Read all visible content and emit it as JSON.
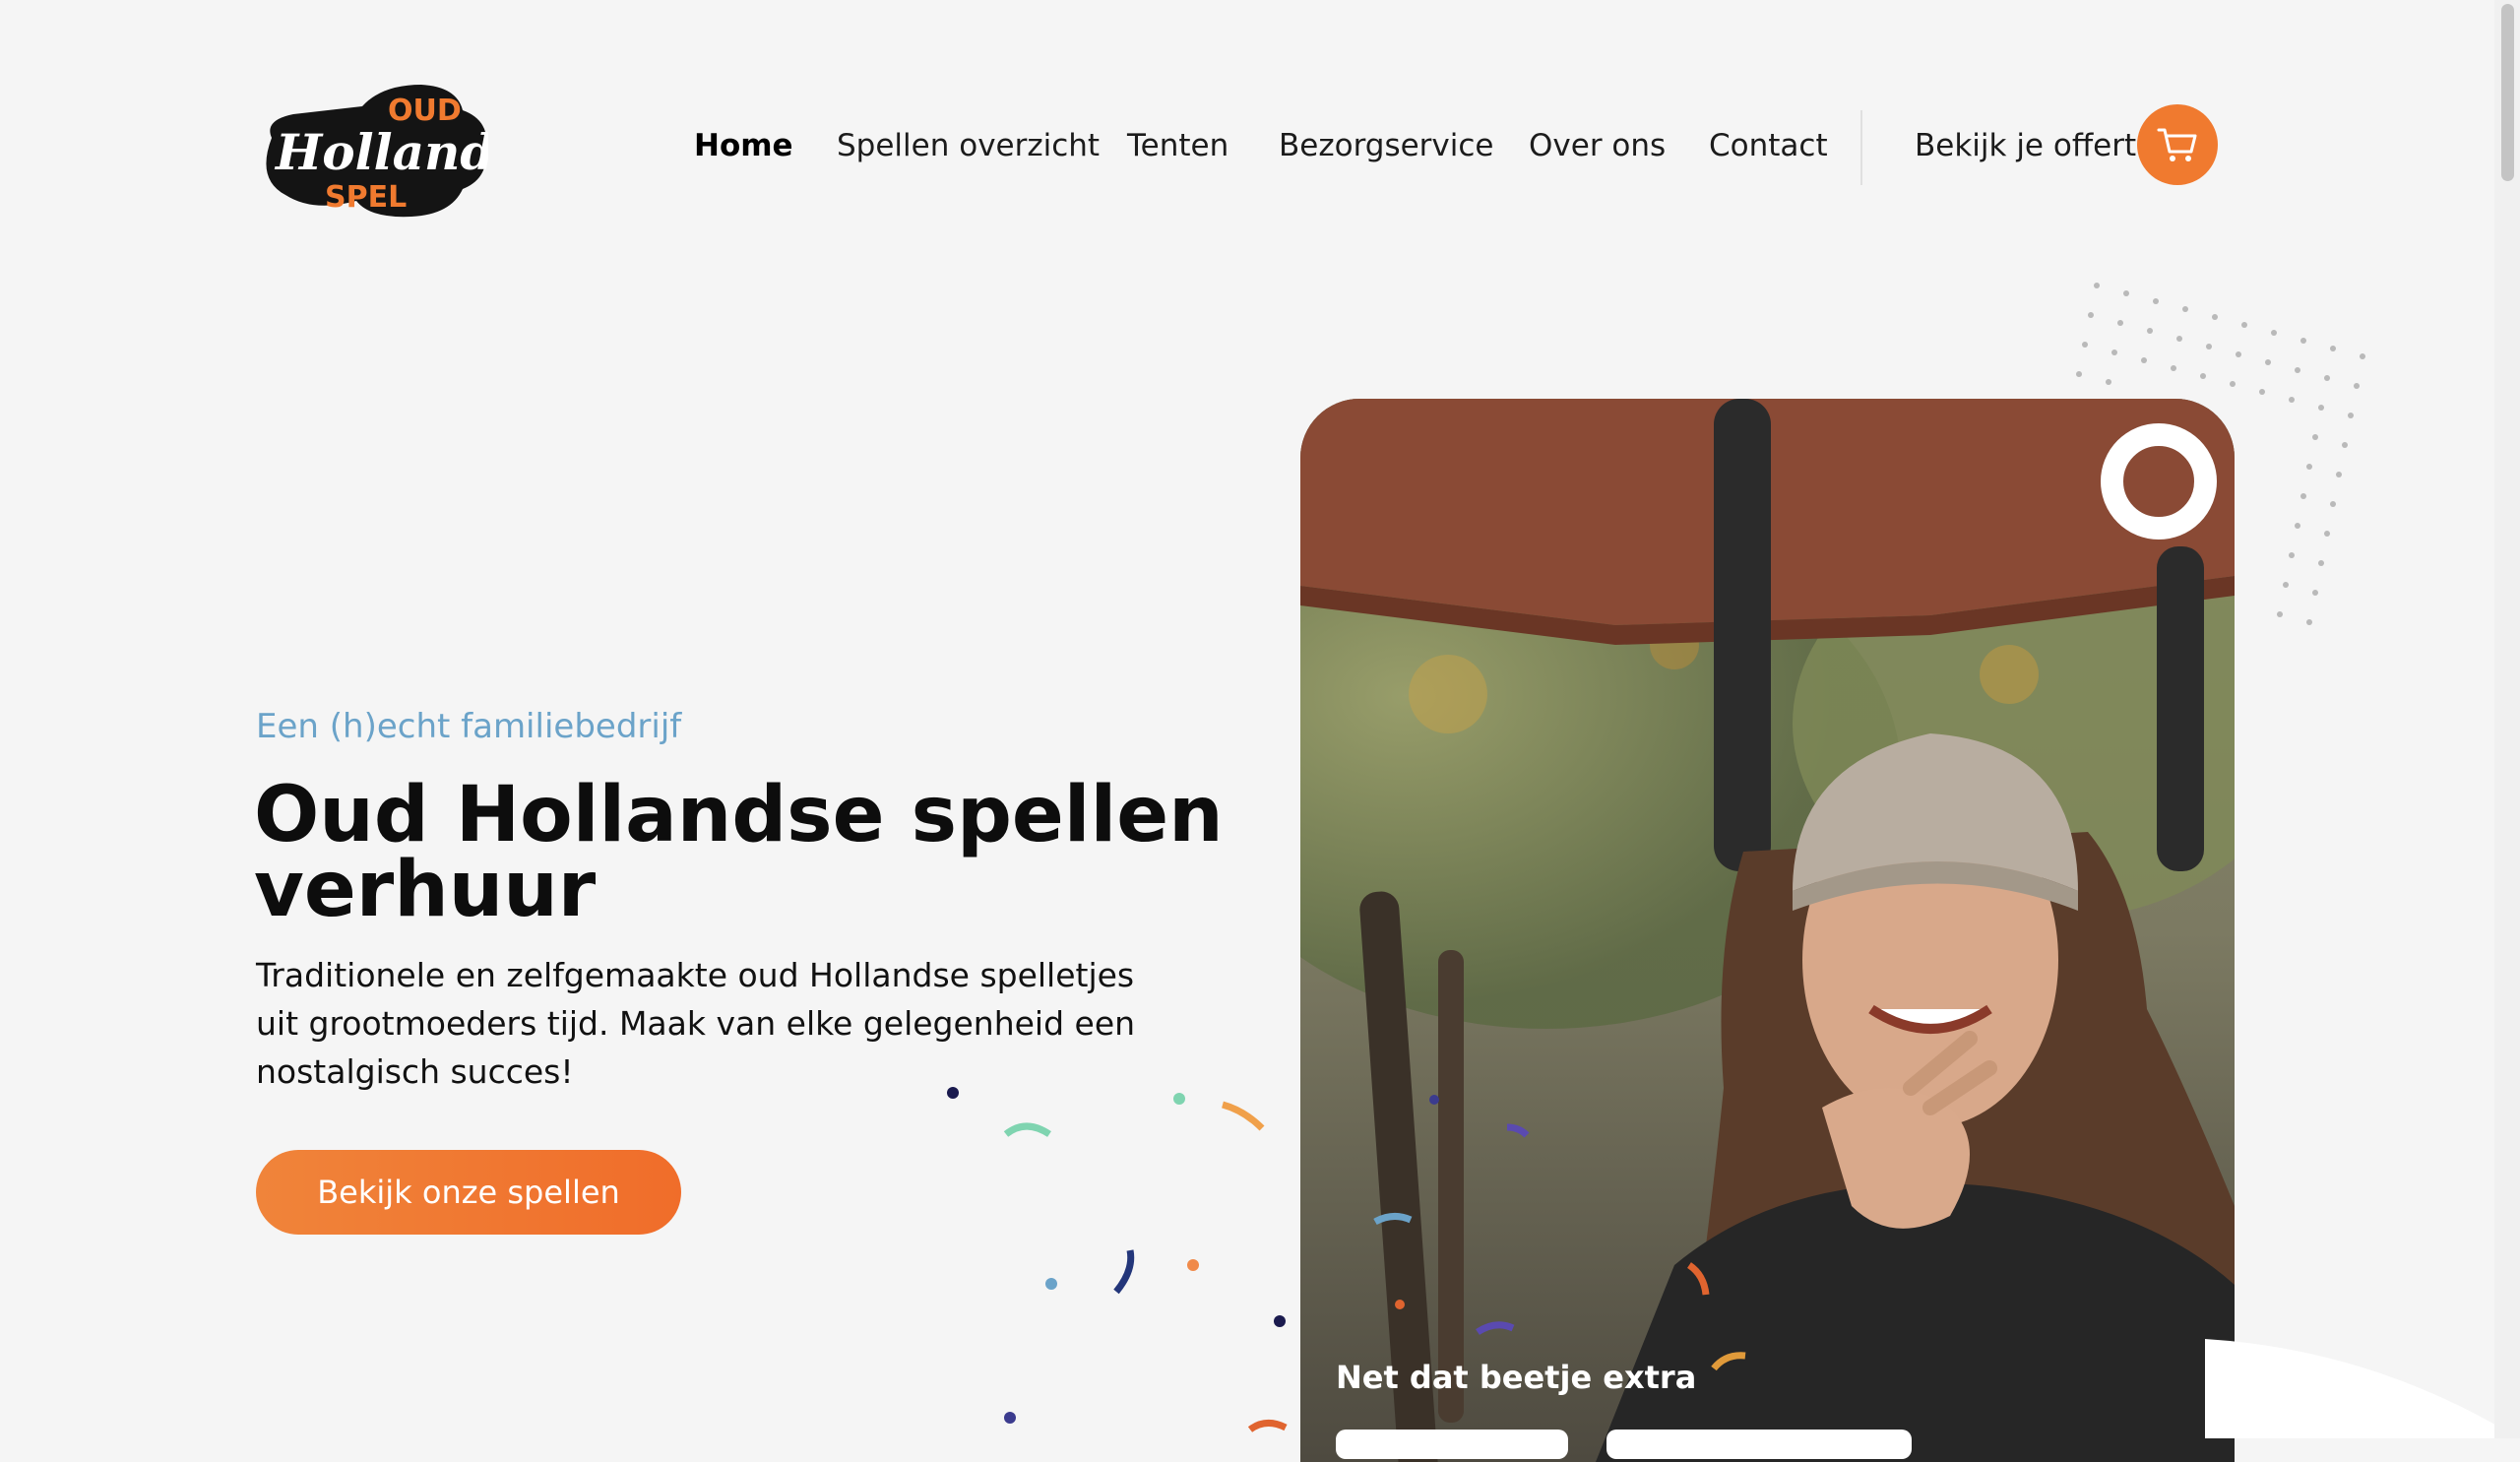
{
  "logo": {
    "top_text": "OUD",
    "middle_text": "Hollands",
    "bottom_text": "SPEL"
  },
  "nav": {
    "items": [
      {
        "label": "Home",
        "active": true
      },
      {
        "label": "Spellen overzicht"
      },
      {
        "label": "Tenten"
      },
      {
        "label": "Bezorgservice"
      },
      {
        "label": "Over ons"
      },
      {
        "label": "Contact"
      }
    ],
    "quote_label": "Bekijk je offerte",
    "cart_icon": "cart-icon"
  },
  "hero": {
    "eyebrow": "Een (h)echt familiebedrijf",
    "title": "Oud Hollandse spellen verhuur",
    "description": "Traditionele en zelfgemaakte oud Hollandse spelletjes uit grootmoeders tijd. Maak van elke gelegenheid een nostalgisch succes!",
    "cta_label": "Bekijk onze spellen",
    "card_caption": "Net dat beetje extra"
  },
  "colors": {
    "accent": "#f07a2f",
    "eyebrow": "#6ba3c9",
    "background": "#f5f5f5",
    "text": "#111111"
  }
}
